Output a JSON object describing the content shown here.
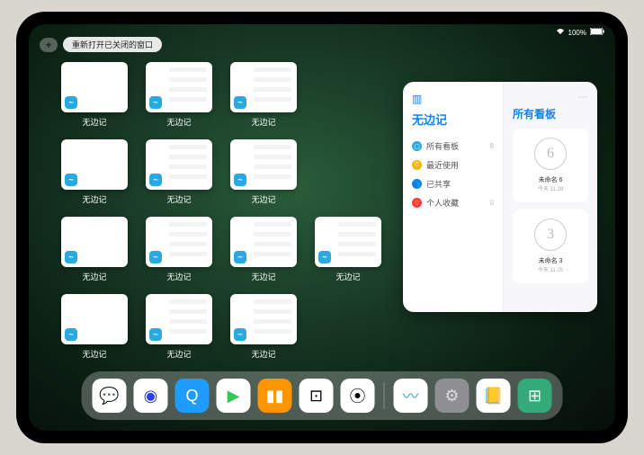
{
  "status": {
    "battery_text": "100%"
  },
  "topbar": {
    "plus": "+",
    "reopen_label": "重新打开已关闭的窗口"
  },
  "app_grid": {
    "label": "无边记",
    "windows": [
      {
        "style": "plain"
      },
      {
        "style": "content"
      },
      {
        "style": "content"
      },
      null,
      {
        "style": "plain"
      },
      {
        "style": "content"
      },
      {
        "style": "content"
      },
      null,
      {
        "style": "plain"
      },
      {
        "style": "content"
      },
      {
        "style": "content"
      },
      {
        "style": "content"
      },
      {
        "style": "plain"
      },
      {
        "style": "content"
      },
      {
        "style": "content"
      },
      null
    ]
  },
  "panel": {
    "title": "无边记",
    "nav": [
      {
        "color": "#2aa8e0",
        "glyph": "▢",
        "label": "所有看板",
        "count": "8"
      },
      {
        "color": "#f7b500",
        "glyph": "⏱",
        "label": "最近使用",
        "count": ""
      },
      {
        "color": "#0a84ff",
        "glyph": "👥",
        "label": "已共享",
        "count": ""
      },
      {
        "color": "#ff3b30",
        "glyph": "♡",
        "label": "个人收藏",
        "count": "0"
      }
    ],
    "right_title": "所有看板",
    "boards": [
      {
        "sketch": "6",
        "name": "未命名 6",
        "sub": "今天 11:28"
      },
      {
        "sketch": "3",
        "name": "未命名 3",
        "sub": "今天 11:25"
      }
    ]
  },
  "dock": {
    "items": [
      {
        "name": "wechat",
        "bg": "#fff",
        "glyph": "💬",
        "color": "#09bb07"
      },
      {
        "name": "quark",
        "bg": "#fff",
        "glyph": "◉",
        "color": "#2a3df5"
      },
      {
        "name": "qqbrowser",
        "bg": "#1e9cff",
        "glyph": "Q",
        "color": "#fff"
      },
      {
        "name": "play",
        "bg": "#fff",
        "glyph": "▶",
        "color": "#34c759"
      },
      {
        "name": "books",
        "bg": "#ff9500",
        "glyph": "▮▮",
        "color": "#fff"
      },
      {
        "name": "dice",
        "bg": "#fff",
        "glyph": "⊡",
        "color": "#000"
      },
      {
        "name": "connect",
        "bg": "#fff",
        "glyph": "⦿",
        "color": "#000"
      }
    ],
    "right_items": [
      {
        "name": "freeform",
        "bg": "#fff",
        "glyph": "〰",
        "color": "#2aa8e0"
      },
      {
        "name": "settings",
        "bg": "#8e8e93",
        "glyph": "⚙",
        "color": "#ddd"
      },
      {
        "name": "notes",
        "bg": "#fff",
        "glyph": "📒",
        "color": "#fc0"
      },
      {
        "name": "app-library",
        "bg": "#3a7",
        "glyph": "⊞",
        "color": "#fff"
      }
    ]
  }
}
